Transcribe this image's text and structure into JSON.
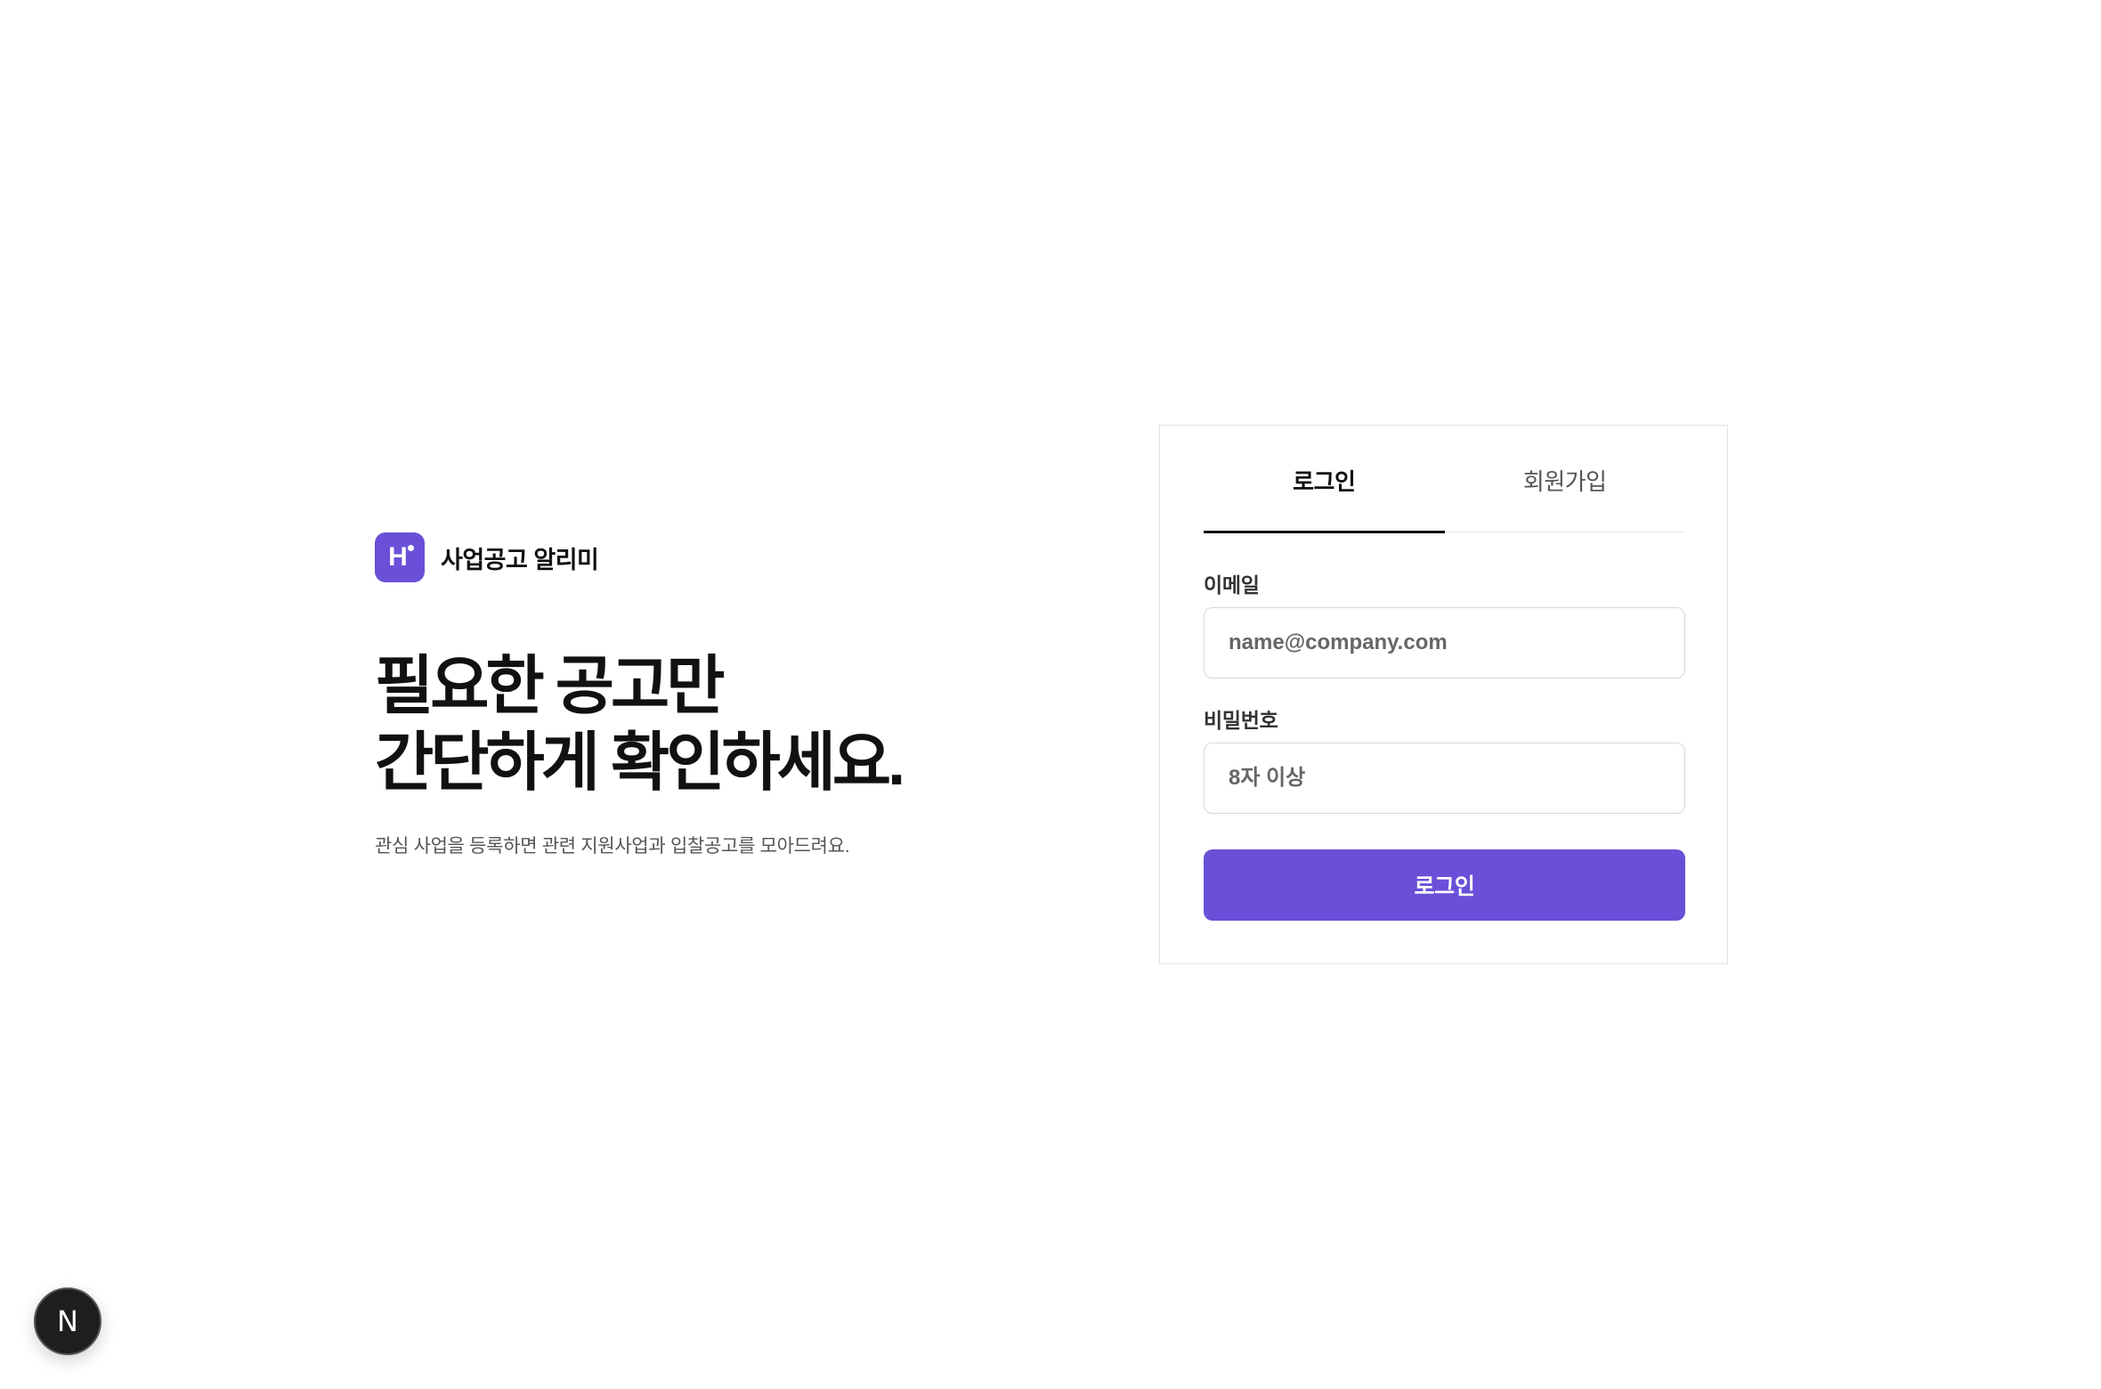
{
  "brand": {
    "logo_letter": "H",
    "name": "사업공고 알리미",
    "color": "#6a50d8"
  },
  "hero": {
    "headline_line1": "필요한 공고만",
    "headline_line2": "간단하게 확인하세요.",
    "subtitle": "관심 사업을 등록하면 관련 지원사업과 입찰공고를 모아드려요."
  },
  "auth": {
    "tabs": [
      {
        "label": "로그인",
        "active": true
      },
      {
        "label": "회원가입",
        "active": false
      }
    ],
    "email": {
      "label": "이메일",
      "placeholder": "name@company.com",
      "value": ""
    },
    "password": {
      "label": "비밀번호",
      "placeholder": "8자 이상",
      "value": ""
    },
    "submit_label": "로그인"
  },
  "dev_badge": {
    "letter": "N",
    "icon": "nextjs-icon"
  }
}
